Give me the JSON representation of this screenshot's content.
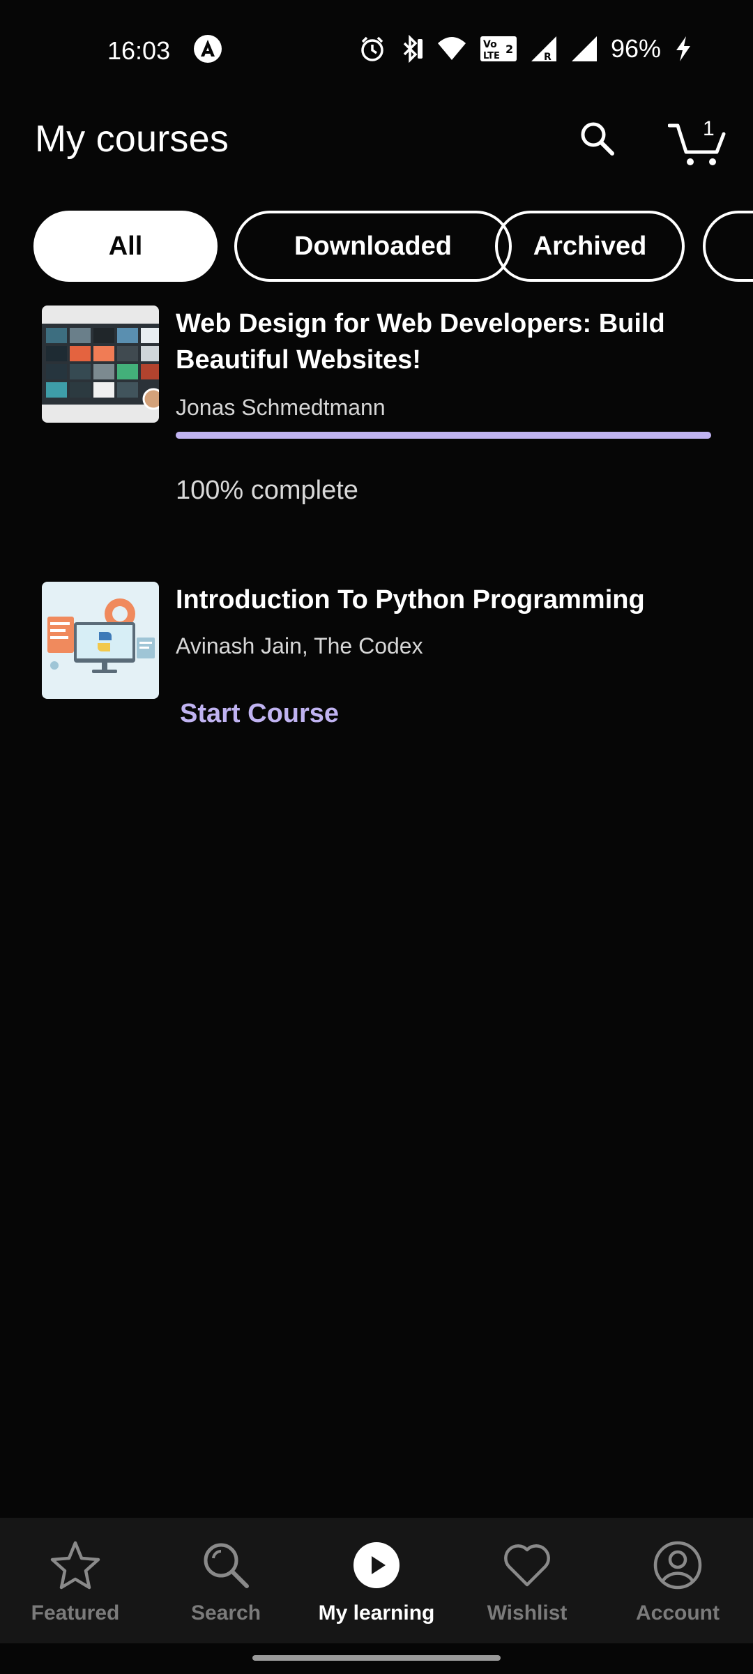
{
  "status_bar": {
    "time": "16:03",
    "battery": "96%",
    "icons": [
      "app-a-icon",
      "alarm-icon",
      "bluetooth-icon",
      "wifi-icon",
      "volte-icon",
      "signal-r-icon",
      "signal-icon",
      "charging-icon"
    ]
  },
  "header": {
    "title": "My courses",
    "cart_count": "1",
    "icons": [
      "search-icon",
      "cart-icon"
    ]
  },
  "filters": {
    "items": [
      {
        "label": "All",
        "active": true
      },
      {
        "label": "Downloaded",
        "active": false
      },
      {
        "label": "Archived",
        "active": false
      }
    ]
  },
  "courses": [
    {
      "title": "Web Design for Web Developers: Build Beautiful Websites!",
      "author": "Jonas Schmedtmann",
      "progress": 1.0,
      "status_text": "100% complete"
    },
    {
      "title": "Introduction To Python Programming",
      "author": "Avinash Jain, The Codex",
      "action_label": "Start Course"
    }
  ],
  "bottom_nav": {
    "items": [
      {
        "label": "Featured",
        "icon": "star-icon",
        "active": false
      },
      {
        "label": "Search",
        "icon": "search-icon",
        "active": false
      },
      {
        "label": "My learning",
        "icon": "play-circle-icon",
        "active": true
      },
      {
        "label": "Wishlist",
        "icon": "heart-icon",
        "active": false
      },
      {
        "label": "Account",
        "icon": "account-icon",
        "active": false
      }
    ]
  },
  "colors": {
    "background": "#060606",
    "accent": "#c0b3f1",
    "nav_background": "#161616"
  }
}
